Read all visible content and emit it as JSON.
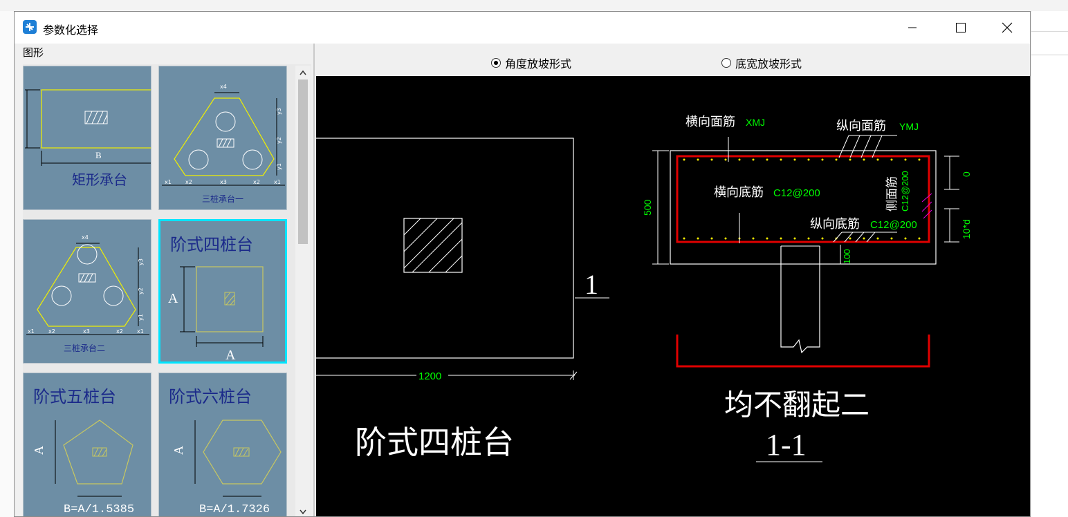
{
  "window": {
    "title": "参数化选择"
  },
  "left_panel": {
    "group_label": "图形",
    "thumbnails": [
      {
        "label": "矩形承台",
        "dim_b": "B"
      },
      {
        "label": "三桩承台一",
        "dims": [
          "x4",
          "y3",
          "y2",
          "y1",
          "x1",
          "x2",
          "x3",
          "x2",
          "x1"
        ]
      },
      {
        "label": "三桩承台二",
        "dims": [
          "x4",
          "y3",
          "y2",
          "y1",
          "x1",
          "x2",
          "x3",
          "x2",
          "x1"
        ]
      },
      {
        "label": "阶式四桩台",
        "dim_a_side": "A",
        "dim_a_bottom": "A",
        "selected": true
      },
      {
        "label": "阶式五桩台",
        "dim_a": "A",
        "formula": "B=A/1.5385"
      },
      {
        "label": "阶式六桩台",
        "dim_a": "A",
        "formula": "B=A/1.7326"
      }
    ]
  },
  "options": {
    "radio_angle": "角度放坡形式",
    "radio_width": "底宽放坡形式",
    "selected": "angle"
  },
  "preview": {
    "plan_title": "阶式四桩台",
    "plan_width": "1200",
    "section_marker": "1",
    "section_title": "均不翻起二",
    "section_label": "1-1",
    "transverse_top": "横向面筋",
    "transverse_top_code": "XMJ",
    "longitudinal_top": "纵向面筋",
    "longitudinal_top_code": "YMJ",
    "transverse_bottom": "横向底筋",
    "transverse_bottom_code": "C12@200",
    "longitudinal_bottom": "纵向底筋",
    "longitudinal_bottom_code": "C12@200",
    "side_bar": "侧面筋",
    "side_bar_code": "C12@200",
    "height_dim": "500",
    "dim_zero": "0",
    "dim_10d": "10*d",
    "dim_100": "100",
    "colors": {
      "rebar": "#e00000",
      "label_green": "#00ff00",
      "dim_white": "#ffffff"
    }
  }
}
